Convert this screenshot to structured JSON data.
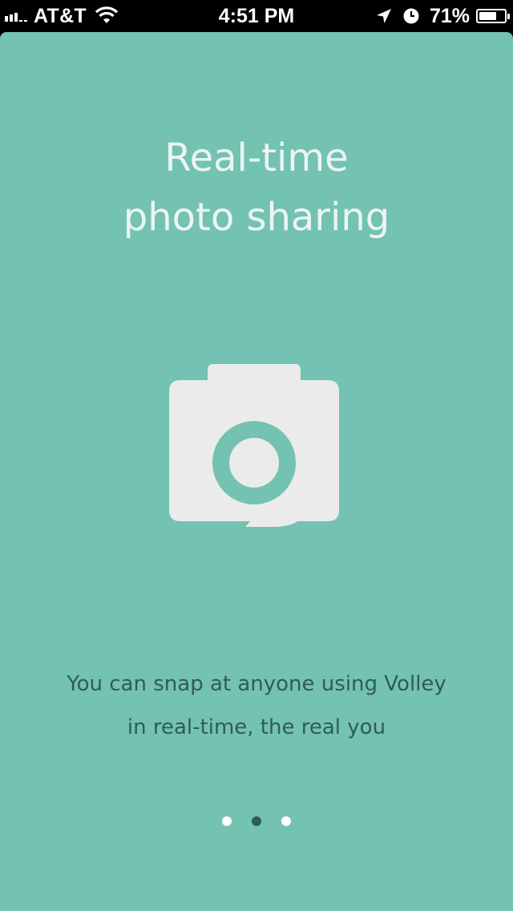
{
  "status_bar": {
    "carrier": "AT&T",
    "time": "4:51 PM",
    "battery_percent_label": "71%",
    "battery_level": 0.71,
    "icons": [
      "signal-icon",
      "wifi-icon",
      "location-icon",
      "alarm-icon",
      "battery-icon"
    ]
  },
  "onboarding": {
    "title_line1": "Real-time",
    "title_line2": "photo sharing",
    "illustration_icon": "camera-speech-bubble-icon",
    "description_line1": "You can snap at anyone using Volley",
    "description_line2": "in real-time, the real you",
    "page_count": 3,
    "active_page": 2
  },
  "colors": {
    "background": "#74c2b1",
    "title_text": "#ebf5f2",
    "body_text": "#2f5d53",
    "illustration": "#ebebeb",
    "dot_inactive": "#ffffff",
    "dot_active": "#2f5d53"
  }
}
